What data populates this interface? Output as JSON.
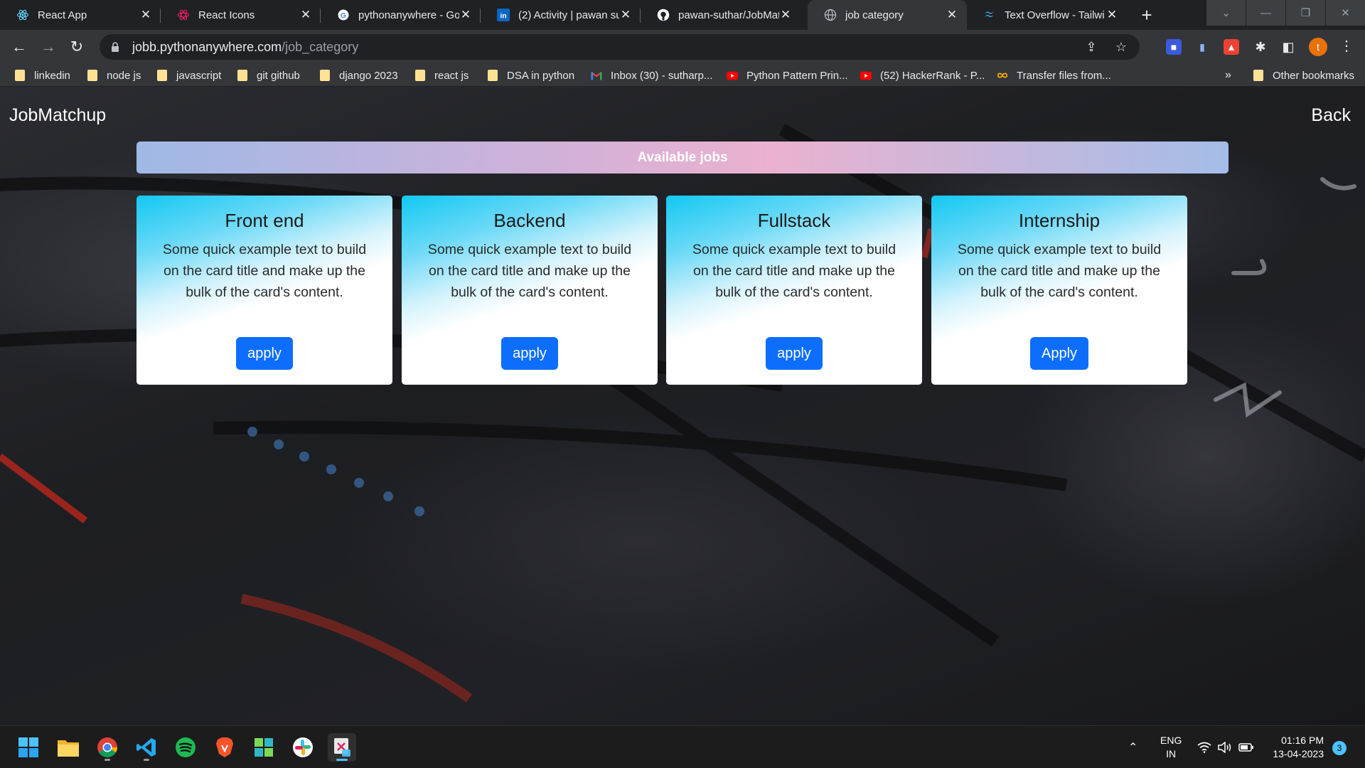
{
  "browser": {
    "tabs": [
      {
        "title": "React App",
        "icon": "react-icon"
      },
      {
        "title": "React Icons",
        "icon": "react-icons-icon"
      },
      {
        "title": "pythonanywhere - Go",
        "icon": "google-icon"
      },
      {
        "title": "(2) Activity | pawan su",
        "icon": "linkedin-icon"
      },
      {
        "title": "pawan-suthar/JobMat",
        "icon": "github-icon"
      },
      {
        "title": "job category",
        "icon": "globe-icon"
      },
      {
        "title": "Text Overflow - Tailwi",
        "icon": "tailwind-icon"
      }
    ],
    "active_tab_index": 5,
    "url_domain": "jobb.pythonanywhere.com",
    "url_path": "/job_category",
    "profile_initial": "t",
    "bookmarks": [
      {
        "label": "linkedin",
        "icon": "folder-icon"
      },
      {
        "label": "node js",
        "icon": "folder-icon"
      },
      {
        "label": "javascript",
        "icon": "folder-icon"
      },
      {
        "label": "git github",
        "icon": "folder-icon"
      },
      {
        "label": "django 2023",
        "icon": "folder-icon"
      },
      {
        "label": "react js",
        "icon": "folder-icon"
      },
      {
        "label": "DSA in python",
        "icon": "folder-icon"
      },
      {
        "label": "Inbox (30) - sutharp...",
        "icon": "gmail-icon"
      },
      {
        "label": "Python Pattern Prin...",
        "icon": "youtube-icon"
      },
      {
        "label": "(52) HackerRank - P...",
        "icon": "youtube-icon"
      },
      {
        "label": "Transfer files from...",
        "icon": "infinity-icon"
      }
    ],
    "bookmarks_overflow": "»",
    "other_bookmarks": "Other bookmarks"
  },
  "app": {
    "brand": "JobMatchup",
    "back_label": "Back",
    "banner_title": "Available jobs",
    "cards": [
      {
        "title": "Front end",
        "text": "Some quick example text to build on the card title and make up the bulk of the card's content.",
        "button": "apply"
      },
      {
        "title": "Backend",
        "text": "Some quick example text to build on the card title and make up the bulk of the card's content.",
        "button": "apply"
      },
      {
        "title": "Fullstack",
        "text": "Some quick example text to build on the card title and make up the bulk of the card's content.",
        "button": "apply"
      },
      {
        "title": "Internship",
        "text": "Some quick example text to build on the card title and make up the bulk of the card's content.",
        "button": "Apply"
      }
    ]
  },
  "taskbar": {
    "apps": [
      "windows-start-icon",
      "file-explorer-icon",
      "chrome-icon",
      "vscode-icon",
      "spotify-icon",
      "brave-icon",
      "app-icon",
      "slack-icon",
      "snipping-tool-icon"
    ],
    "lang_line1": "ENG",
    "lang_line2": "IN",
    "time": "01:16 PM",
    "date": "13-04-2023",
    "notification_count": "3"
  },
  "colors": {
    "primary_button": "#0d6efd",
    "banner_gradient": [
      "#9fb8e6",
      "#ebb1cf",
      "#a3bde8"
    ],
    "card_gradient_top": "#12c8f2",
    "tab_active": "#35363a",
    "chrome_dark": "#202124"
  }
}
